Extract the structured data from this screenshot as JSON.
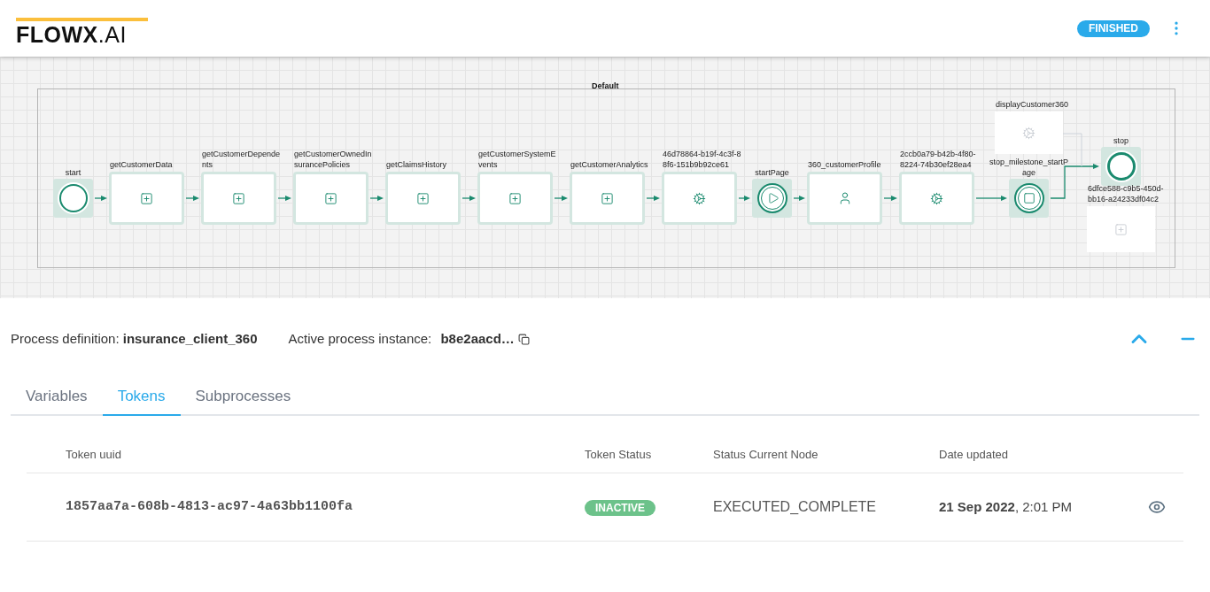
{
  "header": {
    "logo_main": "FLOWX",
    "logo_suffix": ".AI",
    "status": "FINISHED"
  },
  "diagram": {
    "pool_label": "Default",
    "nodes": [
      {
        "label": "start",
        "kind": "start",
        "faded": false
      },
      {
        "label": "getCustomerData",
        "kind": "subprocess",
        "faded": false
      },
      {
        "label": "getCustomerDependents",
        "kind": "subprocess",
        "faded": false
      },
      {
        "label": "getCustomerOwnedInsurancePolicies",
        "kind": "subprocess",
        "faded": false
      },
      {
        "label": "getClaimsHistory",
        "kind": "subprocess",
        "faded": false
      },
      {
        "label": "getCustomerSystemEvents",
        "kind": "subprocess",
        "faded": false
      },
      {
        "label": "getCustomerAnalytics",
        "kind": "subprocess",
        "faded": false
      },
      {
        "label": "46d78864-b19f-4c3f-88f6-151b9b92ce61",
        "kind": "service",
        "faded": false
      },
      {
        "label": "startPage",
        "kind": "page_start",
        "faded": false
      },
      {
        "label": "360_customerProfile",
        "kind": "user",
        "faded": false
      },
      {
        "label": "2ccb0a79-b42b-4f80-8224-74b30ef28ea4",
        "kind": "service",
        "faded": false
      },
      {
        "label": "stop_milestone_startPage",
        "kind": "milestone",
        "faded": false
      },
      {
        "label": "stop",
        "kind": "end",
        "faded": false
      },
      {
        "label": "displayCustomer360",
        "kind": "service",
        "faded": true
      },
      {
        "label": "6dfce588-c9b5-450d-bb16-a24233df04c2",
        "kind": "subprocess",
        "faded": true
      }
    ]
  },
  "process": {
    "definition_label": "Process definition:",
    "definition": "insurance_client_360",
    "instance_label": "Active process instance:",
    "instance": "b8e2aacd…"
  },
  "tabs": [
    {
      "label": "Variables",
      "selected": false
    },
    {
      "label": "Tokens",
      "selected": true
    },
    {
      "label": "Subprocesses",
      "selected": false
    }
  ],
  "table": {
    "columns": [
      "Token uuid",
      "Token Status",
      "Status Current Node",
      "Date updated"
    ],
    "rows": [
      {
        "uuid": "1857aa7a-608b-4813-ac97-4a63bb1100fa",
        "status": "INACTIVE",
        "color": "#6cc28a",
        "node": "EXECUTED_COMPLETE",
        "date": "**21 Sep 2022**, 2:01 PM"
      }
    ]
  }
}
